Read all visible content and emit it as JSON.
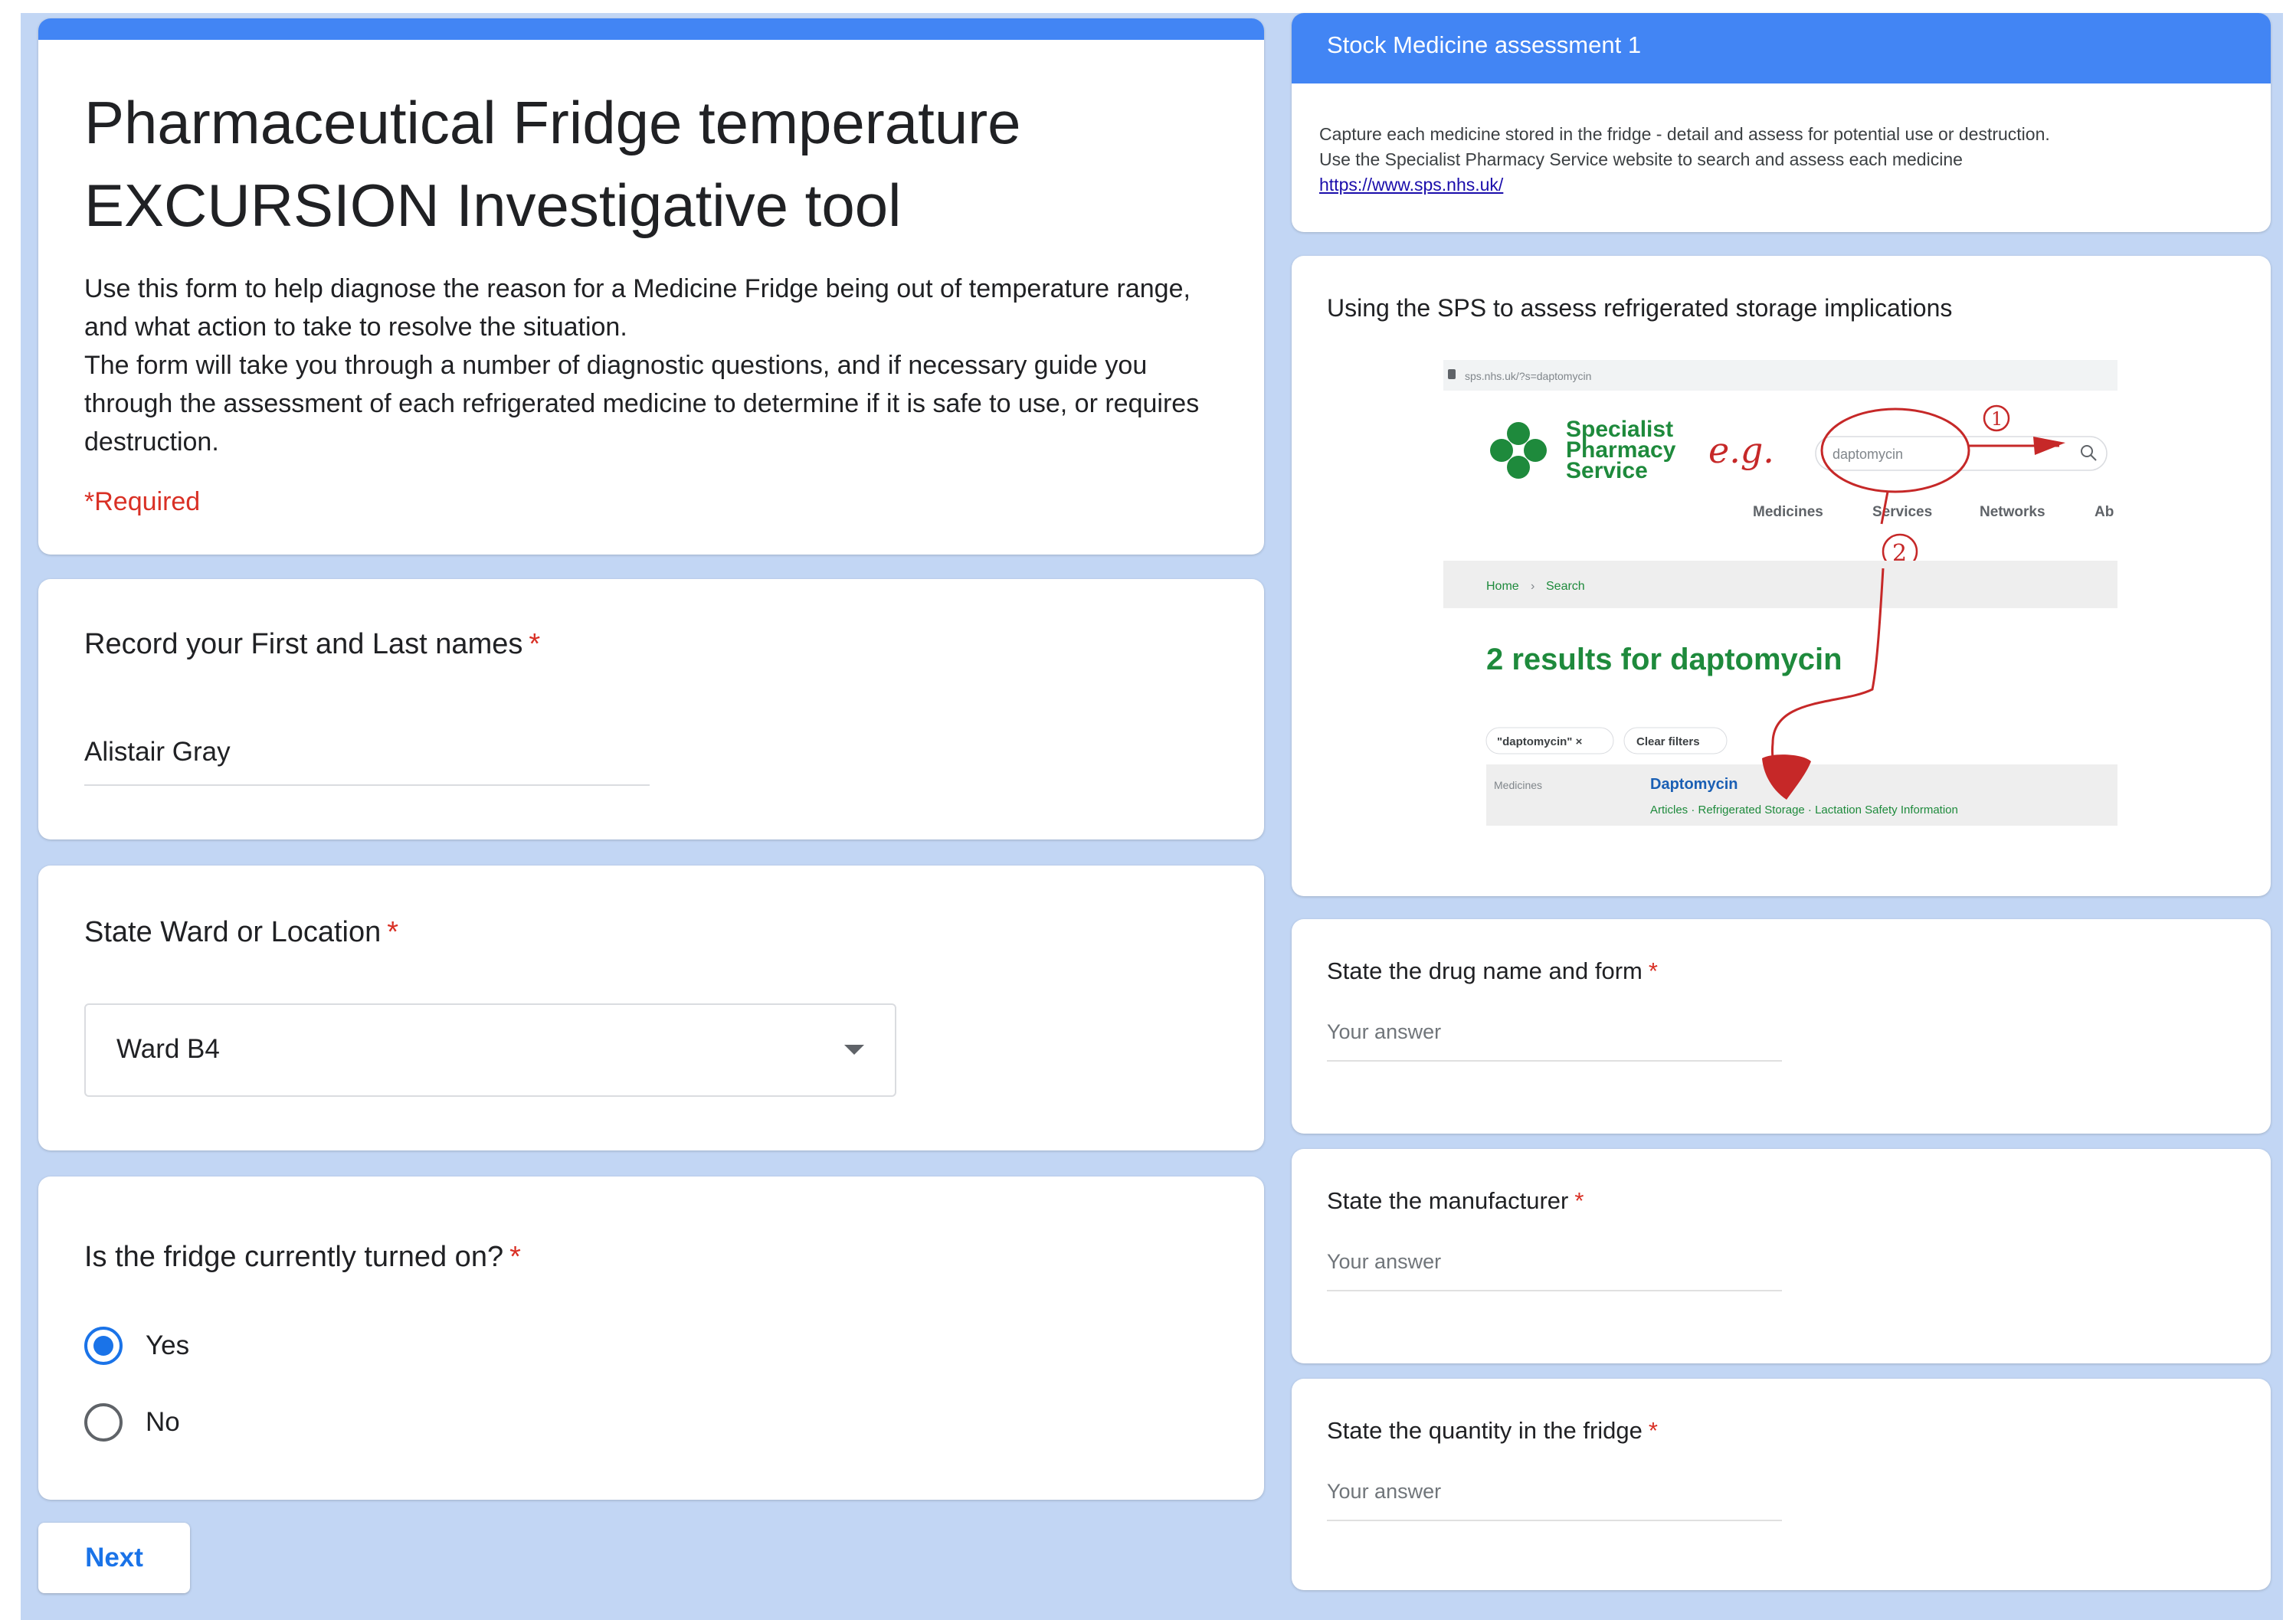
{
  "form": {
    "title_line1": "Pharmaceutical Fridge temperature",
    "title_line2": "EXCURSION Investigative tool",
    "description": [
      "Use this form to help diagnose the reason for a Medicine Fridge being out of temperature range, and what action to take to resolve the situation.",
      "The form will take you through a number of diagnostic questions, and if necessary guide you through the assessment of each refrigerated medicine to determine if it is safe to use, or requires destruction."
    ],
    "required_note": "*Required",
    "star": "*",
    "colors": {
      "accent": "#4285f4",
      "primary_blue": "#1a73e8",
      "required_red": "#d93025",
      "page_background": "#c2d6f4"
    }
  },
  "questions": {
    "name": {
      "label": "Record your First and Last names",
      "value": "Alistair Gray"
    },
    "ward": {
      "label": "State Ward or Location",
      "selected": "Ward B4"
    },
    "fridge_on": {
      "label": "Is the fridge currently turned on?",
      "options": [
        {
          "label": "Yes",
          "checked": true
        },
        {
          "label": "No",
          "checked": false
        }
      ]
    }
  },
  "next_label": "Next",
  "section": {
    "title": "Stock Medicine assessment 1",
    "desc_line1": "Capture each medicine stored in the fridge - detail and assess for potential use or destruction.",
    "desc_line2": "Use the Specialist Pharmacy Service website to search and assess each medicine",
    "link": "https://www.sps.nhs.uk/"
  },
  "sps_image": {
    "title": "Using the SPS to assess refrigerated storage implications",
    "url_bar": "sps.nhs.uk/?s=daptomycin",
    "logo_line1": "Specialist",
    "logo_line2": "Pharmacy",
    "logo_line3": "Service",
    "handwriting_eg": "e.g.",
    "search_text": "daptomycin",
    "nav": [
      "Medicines",
      "Services",
      "Networks",
      "Ab"
    ],
    "annotation_1": "1",
    "annotation_2": "2",
    "breadcrumb_home": "Home",
    "breadcrumb_sep": "›",
    "breadcrumb_search": "Search",
    "results_heading": "2 results for daptomycin",
    "filter_chip": "\"daptomycin\" ×",
    "clear_filters": "Clear filters",
    "row_category": "Medicines",
    "row_title": "Daptomycin",
    "row_links": "Articles · Refrigerated Storage · Lactation Safety Information"
  },
  "right_questions": {
    "drug": {
      "label": "State the drug name and form",
      "placeholder": "Your answer"
    },
    "manufacturer": {
      "label": "State the manufacturer",
      "placeholder": "Your answer"
    },
    "quantity": {
      "label": "State the quantity in the fridge",
      "placeholder": "Your answer"
    }
  }
}
